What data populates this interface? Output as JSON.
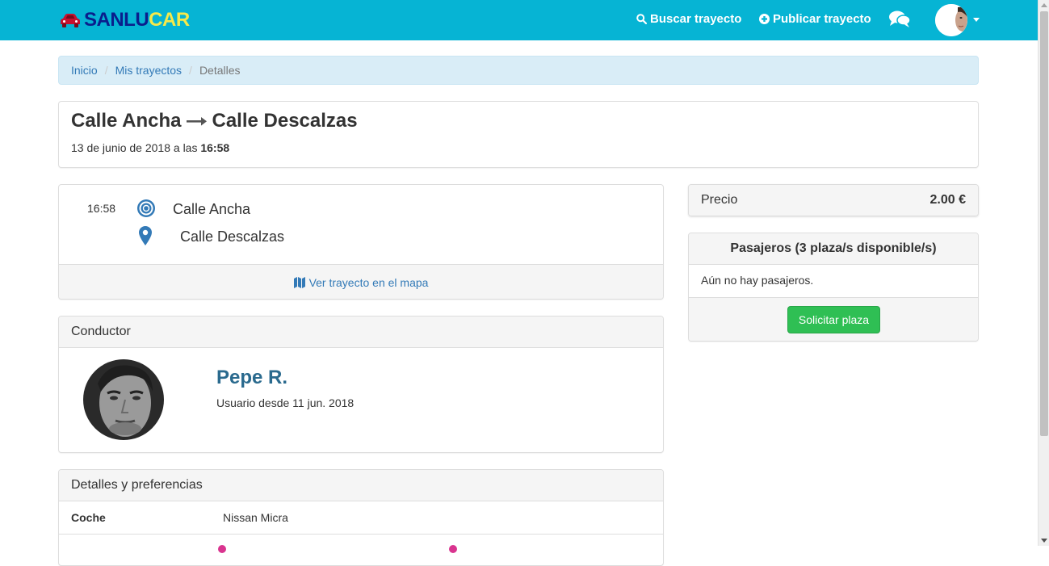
{
  "navbar": {
    "brand_part1": "SANLU",
    "brand_part2": "CAR",
    "brand_color_primary": "#0a1e8c",
    "brand_color_accent": "#f6e94a",
    "bar_color": "#06b4d4",
    "search_label": "Buscar trayecto",
    "publish_label": "Publicar trayecto",
    "icons": [
      "car-icon",
      "search-icon",
      "plus-circle-icon",
      "chat-icon",
      "caret-down-icon"
    ]
  },
  "breadcrumb": {
    "home": "Inicio",
    "my_trips": "Mis trayectos",
    "current": "Detalles"
  },
  "trip": {
    "origin": "Calle Ancha",
    "destination": "Calle Descalzas",
    "date_prefix": "13 de junio de 2018 a las",
    "time": "16:58"
  },
  "route": {
    "departure_time": "16:58",
    "origin": "Calle Ancha",
    "destination": "Calle Descalzas",
    "map_link": "Ver trayecto en el mapa"
  },
  "driver": {
    "heading": "Conductor",
    "name": "Pepe R.",
    "member_since": "Usuario desde 11 jun. 2018"
  },
  "preferences": {
    "heading": "Detalles y preferencias",
    "car_label": "Coche",
    "car_value": "Nissan Micra"
  },
  "price": {
    "label": "Precio",
    "value": "2.00 €"
  },
  "passengers": {
    "heading": "Pasajeros (3 plaza/s disponible/s)",
    "empty_text": "Aún no hay pasajeros.",
    "request_button": "Solicitar plaza",
    "button_color": "#2fbf54"
  }
}
